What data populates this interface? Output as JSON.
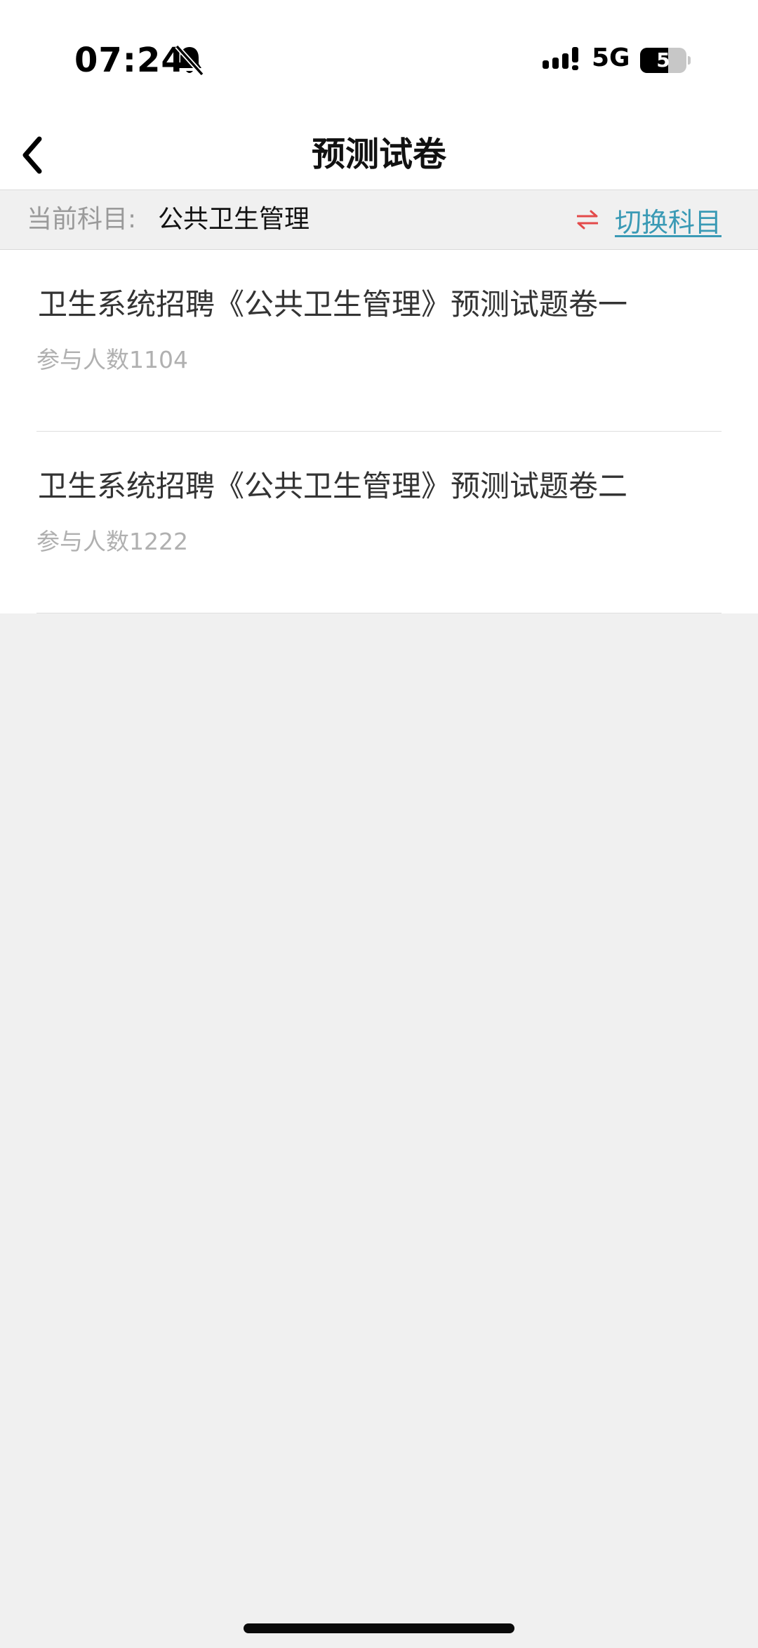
{
  "status_bar": {
    "time": "07:24",
    "network": "5G",
    "battery_level": "5",
    "battery_fraction": 0.6,
    "icons": [
      "bell-slash-icon",
      "signal-icon",
      "battery-icon"
    ]
  },
  "nav": {
    "title": "预测试卷",
    "back_icon": "chevron-left-icon"
  },
  "subject": {
    "label": "当前科目:",
    "value": "公共卫生管理",
    "switch_label": "切换科目",
    "switch_icon": "swap-arrows-icon",
    "switch_icon_color": "#e34a4a",
    "switch_label_color": "#3a9ab5"
  },
  "papers": [
    {
      "title": "卫生系统招聘《公共卫生管理》预测试题卷一",
      "count": "参与人数1104"
    },
    {
      "title": "卫生系统招聘《公共卫生管理》预测试题卷二",
      "count": "参与人数1222"
    }
  ]
}
